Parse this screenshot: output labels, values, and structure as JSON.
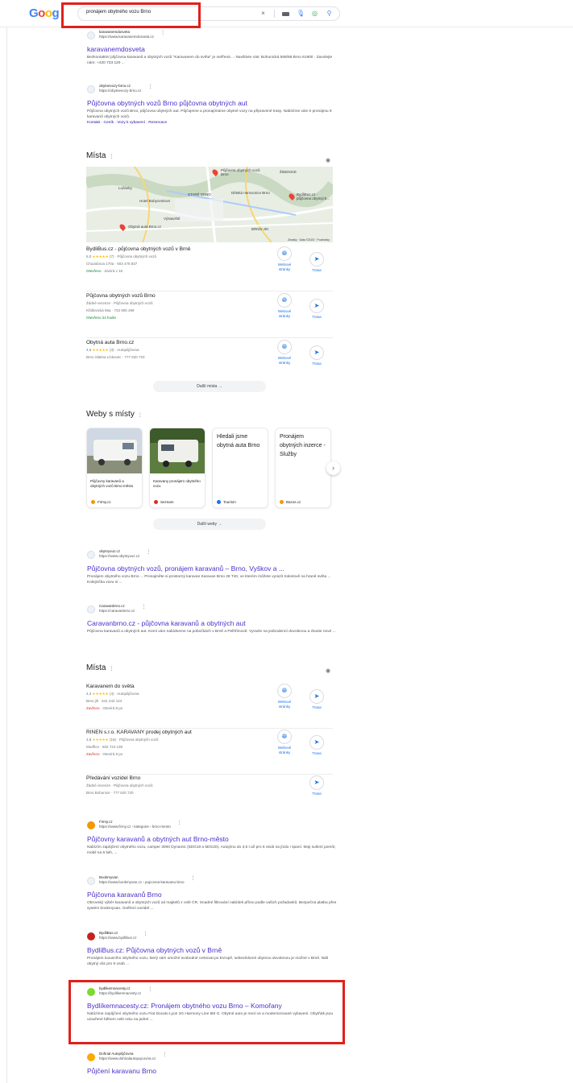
{
  "header": {
    "logo_letters": [
      "G",
      "o",
      "o",
      "g",
      "l",
      "e"
    ],
    "query": "pronájem obytného vozu Brno",
    "icons": [
      "clear-icon",
      "keyboard-icon",
      "mic-icon",
      "lens-icon",
      "search-icon"
    ],
    "icon_glyphs": {
      "clear": "×",
      "mic": "🎙",
      "lens": "◎",
      "search": "⚲"
    }
  },
  "results_top": [
    {
      "site": "karavanemdosveta",
      "url": "https://www.karavanemdosveta.cz",
      "title": "karavanemdosveta",
      "snippet": "Bezkontaktní půjčovna karavanů a obytných vozů \"Karavanem do světa\" je ověřená ... Navštivte nás: Bohunická 568/68 Brno 61900 · Zavolejte nám: +420 733 120 ..."
    },
    {
      "site": "obytnevozy-brno.cz",
      "url": "https://obytnevozy-brno.cz",
      "title": "Půjčovna obytných vozů Brno půjčovna obytných aut",
      "snippet": "Půjčovna obytných vozů Brno, půjčovna obytných aut. Půjčujeme a pronajímáme obytné vozy na připravené trasy. Nabízíme vám k pronájmu 9 karavanů obytných vozů.",
      "links": "Kontakt · Ceník · Vozy k vybavení · Rezervace"
    }
  ],
  "places1": {
    "heading": "Místa",
    "map_labels": [
      "Půjčovna obytných vozů Brno",
      "BydliBus.cz - půjčovna obytných...",
      "Obytná auta Brno.cz",
      "ŽIDENICE",
      "Hotel Bobycentrum",
      "Lužánky",
      "STARÉ BRNO",
      "Výstaviště",
      "BRNO-JIH",
      "Dětská nemocnice Brno"
    ],
    "map_credit": "Zkratky · Data ©2023 · Podmínky",
    "items": [
      {
        "name": "BydliBus.cz - půjčovna obytných vozů v Brně",
        "rating": "5,0",
        "stars": "★★★★★",
        "reviews": "(7)",
        "category": "Půjčovna obytných vozů",
        "address": "Chudobova 170a · 603 478 837",
        "status": "Otevřeno",
        "hours": " · Zavírá v 18",
        "website_label": "Webové stránky",
        "route_label": "Trasa"
      },
      {
        "name": "Půjčovna obytných vozů Brno",
        "rating": "",
        "stars": "",
        "reviews": "",
        "category": "Žádné recenze · Půjčovna obytných vozů",
        "address": "Křidlovická 66a · 733 905 499",
        "status": "Otevřeno 24 hodin",
        "hours": "",
        "website_label": "Webové stránky",
        "route_label": "Trasa"
      },
      {
        "name": "Obytná auta Brno.cz",
        "rating": "4,5",
        "stars": "★★★★★",
        "reviews": "(3)",
        "category": "Autopůjčovna",
        "address": "Brno Slatina Lískovec · 777 620 720",
        "status": "",
        "hours": "",
        "website_label": "Webové stránky",
        "route_label": "Trasa"
      }
    ],
    "more_label": "Další místa"
  },
  "webs": {
    "heading": "Weby s místy",
    "cards": [
      {
        "text": "Půjčovny karavanů a obytných vozů Brno-město",
        "source": "Firmy.cz",
        "dot": "#f29900"
      },
      {
        "text": "Karavany pronájem obytného vozu",
        "source": "Seznam",
        "dot": "#d93025"
      },
      {
        "big": "Hledali jsme obytná auta Brno",
        "source": "Tourism",
        "dot": "#1a73e8"
      },
      {
        "big": "Pronájem obytných inzerce - Služby",
        "source": "Bazos.cz",
        "dot": "#f29900"
      }
    ],
    "more_label": "Další weby"
  },
  "results_mid": [
    {
      "site": "obytnyvuz.cz",
      "url": "https://www.obytnyvuz.cz",
      "title": "Půjčovna obytných vozů, pronájem karavanů – Brno, Vyškov a ...",
      "snippet": "Pronájem obytného vozu Brno ... Pronajměte si prostorný karavan Karavan Brno 28 T40, ve kterém můžete vyrazit Sokolově na hraně světa ... Kolejnička vozu si ..."
    },
    {
      "site": "Caravanbrno.cz",
      "url": "https://caravanbrno.cz",
      "title": "Caravanbrno.cz - půjčovna karavanů a obytných aut",
      "snippet": "Půjčovna karavanů a obytných aut. Kemi vám nabídneme na pobočkách v Brně a Pelhřimově. Vyrazte na jednodenní dovolenou a zkuste nové ..."
    }
  ],
  "places2": {
    "heading": "Místa",
    "items": [
      {
        "name": "Karavanem do světa",
        "rating": "4,3",
        "stars": "★★★★★",
        "reviews": "(4)",
        "category": "Autopůjčovna",
        "address": "Brno jih · 541 242 124",
        "status": "Zavřeno",
        "hours": " · Otevírá 8 po",
        "website_label": "Webové stránky",
        "route_label": "Trasa"
      },
      {
        "name": "RINEN s.r.o. KARAVANY prodej obytných aut",
        "rating": "4,8",
        "stars": "★★★★★",
        "reviews": "(16)",
        "category": "Půjčovna obytných vozů",
        "address": "Modřice · 602 724 139",
        "status": "Zavřeno",
        "hours": " · Otevírá 9 po",
        "website_label": "Webové stránky",
        "route_label": "Trasa"
      },
      {
        "name": "Předávání vozidel Brno",
        "rating": "",
        "stars": "",
        "reviews": "",
        "category": "Žádné recenze · Půjčovna obytných vozů",
        "address": "Brno Bohunice · 777 620 720",
        "status": "",
        "hours": "",
        "website_label": "",
        "route_label": "Trasa"
      }
    ]
  },
  "results_bottom": [
    {
      "site": "Firmy.cz",
      "url": "https://www.firmy.cz › kategorie › brno-mesto",
      "title": "Půjčovny karavanů a obytných aut Brno-město",
      "snippet": "Nabízím zapůjčení obytného vozu, camper 3000 Dynamic (5DG19 a 5DG20). Autojímu do 3,5 t až pro 6 osob na jízdu i spaní. Moji sušení pomôr, mobil na 6 lieh, ..."
    },
    {
      "site": "Bookmyvan",
      "url": "https://www.bookmyvan.cz › pujcovna-karavanu-brno",
      "title": "Půjčovna karavanů Brno",
      "snippet": "Obrovský výběr karavanů a obytných vozů od majitelů z celé ČR. Snadné filtrování nabídek přímo podle vašich požadavků. Bezpečná platba přes systém bookmyvan. Ověření vozidel ..."
    },
    {
      "site": "BydliBus.cz",
      "url": "https://www.bydlibus.cz",
      "title": "BydliBus.cz: Půjčovna obytných vozů v Brně",
      "snippet": "Pronájem luxusního obytného vozu, který vám umožní svobodné cestovat po Evropě, sebevědomé obytnou dovolenou je možné v Brně. Náš obytný vůz pro 6 osob ..."
    },
    {
      "site": "bydlikemnacesty.cz",
      "url": "https://bydlikemnacesty.cz",
      "title": "Bydlíkemnacesty.cz: Pronájem obytného vozu Brno – Komořany",
      "snippet": "Nabízíme zapůjčení obytného vozu Fiat Ducato Lyon 3G Harmony Line 6M G. Obytné auto je mezi vs a modernizované vybavení. Obytňák jsou uzavřené během celé roku na jedné ..."
    },
    {
      "site": "Dohnal Autopůjčovna",
      "url": "https://www.dohnalautopujcovna.cz",
      "title": "Půjčení karavanu Brno",
      "snippet": ""
    }
  ]
}
